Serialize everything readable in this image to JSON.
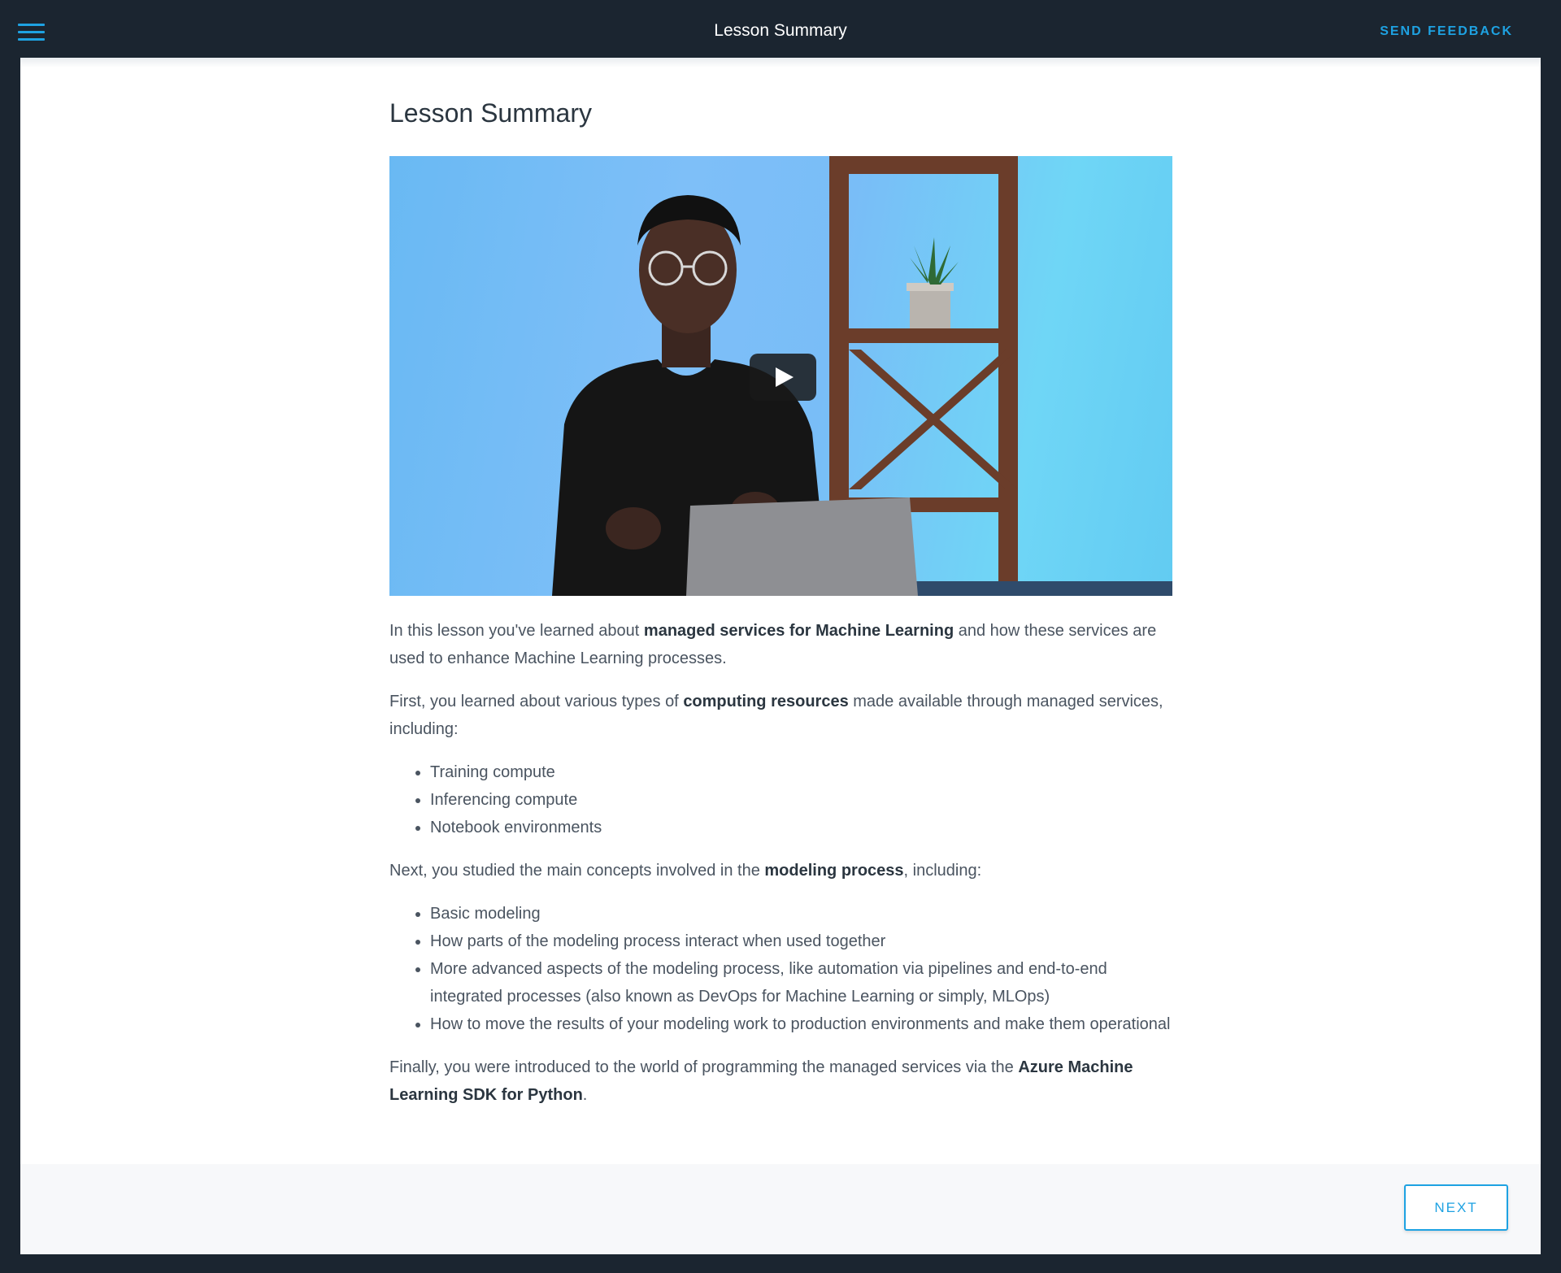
{
  "header": {
    "menu_icon": "hamburger-icon",
    "title": "Lesson Summary",
    "feedback_label": "SEND FEEDBACK"
  },
  "main": {
    "title": "Lesson Summary",
    "video": {
      "play_icon": "play-icon"
    },
    "intro": {
      "before": "In this lesson you've learned about ",
      "bold": "managed services for Machine Learning",
      "after": " and how these services are used to enhance Machine Learning processes."
    },
    "computing": {
      "before": "First, you learned about various types of ",
      "bold": "computing resources",
      "after": " made available through managed services, including:",
      "items": [
        "Training compute",
        "Inferencing compute",
        "Notebook environments"
      ]
    },
    "modeling": {
      "before": "Next, you studied the main concepts involved in the ",
      "bold": "modeling process",
      "after": ", including:",
      "items": [
        "Basic modeling",
        "How parts of the modeling process interact when used together",
        "More advanced aspects of the modeling process, like automation via pipelines and end-to-end integrated processes (also known as DevOps for Machine Learning or simply, MLOps)",
        "How to move the results of your modeling work to production environments and make them operational"
      ]
    },
    "finally": {
      "before": "Finally, you were introduced to the world of programming the managed services via the ",
      "bold": "Azure Machine Learning SDK for Python",
      "after": "."
    }
  },
  "footer": {
    "next_label": "NEXT"
  },
  "colors": {
    "accent": "#1ea2e2",
    "topbar": "#1b2530",
    "text": "#4a5460"
  }
}
